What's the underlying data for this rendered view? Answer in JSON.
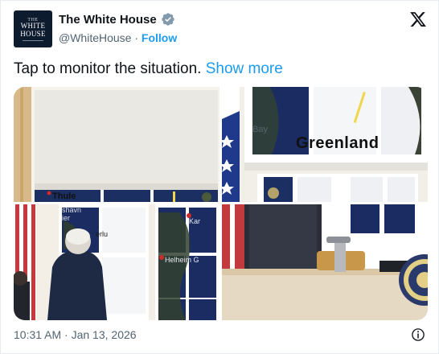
{
  "account": {
    "display_name": "The White House",
    "handle": "@WhiteHouse",
    "separator": "·",
    "follow_label": "Follow",
    "avatar_lines": [
      "THE",
      "WHITE",
      "HOUSE"
    ]
  },
  "tweet": {
    "text": "Tap to monitor the situation.",
    "show_more_label": "Show more",
    "timestamp": "10:31 AM · Jan 13, 2026"
  },
  "media": {
    "image1_labels": {
      "thule": "Thule"
    },
    "image2_labels": {
      "bay": "Bay",
      "greenland": "Greenland"
    },
    "image3_labels": {
      "shavn": "shavn",
      "ier": "ier",
      "kar": "Kar",
      "erlu": "erlu",
      "helheim": "Helheim G"
    }
  },
  "icons": {
    "verified": "verified-badge-icon",
    "x_logo": "x-logo-icon",
    "info": "info-icon"
  },
  "colors": {
    "accent": "#1d9bf0",
    "secondary_text": "#536471",
    "primary_text": "#0f1419"
  }
}
